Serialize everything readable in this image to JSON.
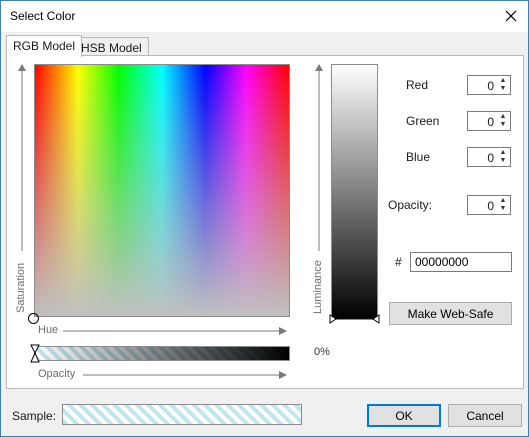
{
  "window": {
    "title": "Select Color"
  },
  "tabs": [
    {
      "label": "RGB Model",
      "active": true
    },
    {
      "label": "HSB Model",
      "active": false
    }
  ],
  "spectrum": {
    "saturation_label": "Saturation",
    "hue_label": "Hue",
    "opacity_label": "Opacity",
    "opacity_percent": "0%"
  },
  "luminance": {
    "label": "Luminance"
  },
  "fields": {
    "red": {
      "label": "Red",
      "value": "0"
    },
    "green": {
      "label": "Green",
      "value": "0"
    },
    "blue": {
      "label": "Blue",
      "value": "0"
    },
    "opacity": {
      "label": "Opacity:",
      "value": "0"
    },
    "hex": {
      "label": "#",
      "value": "00000000"
    }
  },
  "buttons": {
    "web_safe": "Make Web-Safe",
    "ok": "OK",
    "cancel": "Cancel"
  },
  "sample": {
    "label": "Sample:"
  },
  "icons": {
    "close": "close-icon",
    "spin_up": "spin-up-icon",
    "spin_down": "spin-down-icon"
  },
  "colors": {
    "accent": "#0078d7",
    "dialog_border": "#3c7fb1",
    "background": "#f0f0f0"
  }
}
